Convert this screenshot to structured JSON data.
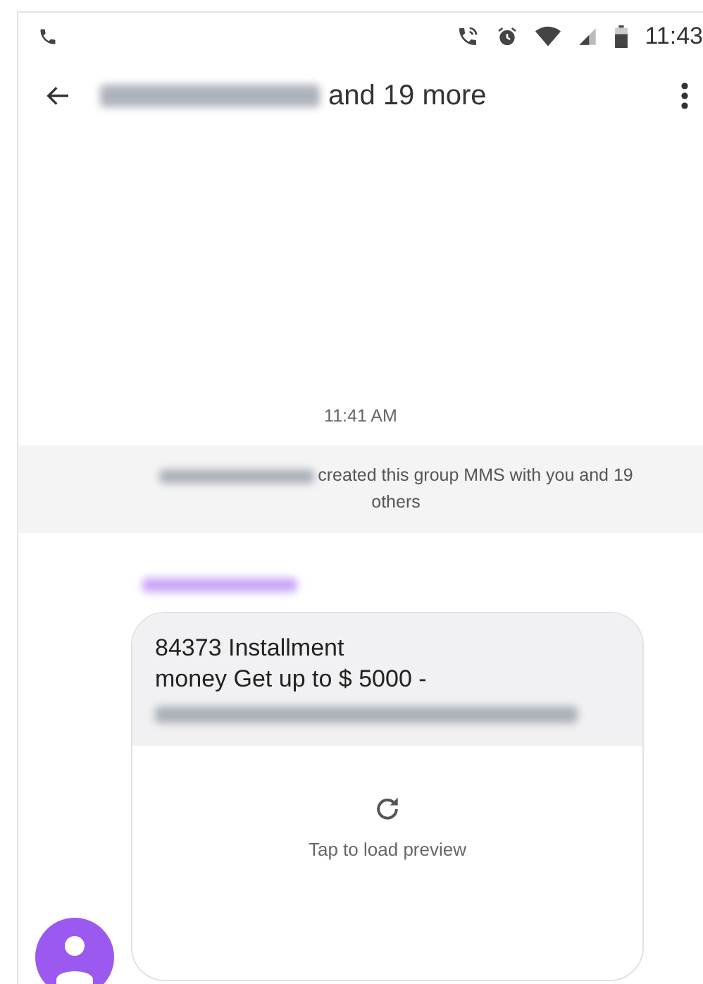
{
  "status_bar": {
    "time": "11:43"
  },
  "header": {
    "title_suffix": "and 19 more"
  },
  "conversation": {
    "timestamp": "11:41 AM",
    "system_message": "created this group MMS with you and 19 others",
    "message": {
      "lines": [
        "84373 Installment",
        "money Get up to $ 5000 -"
      ],
      "preview_label": "Tap to load preview"
    }
  }
}
